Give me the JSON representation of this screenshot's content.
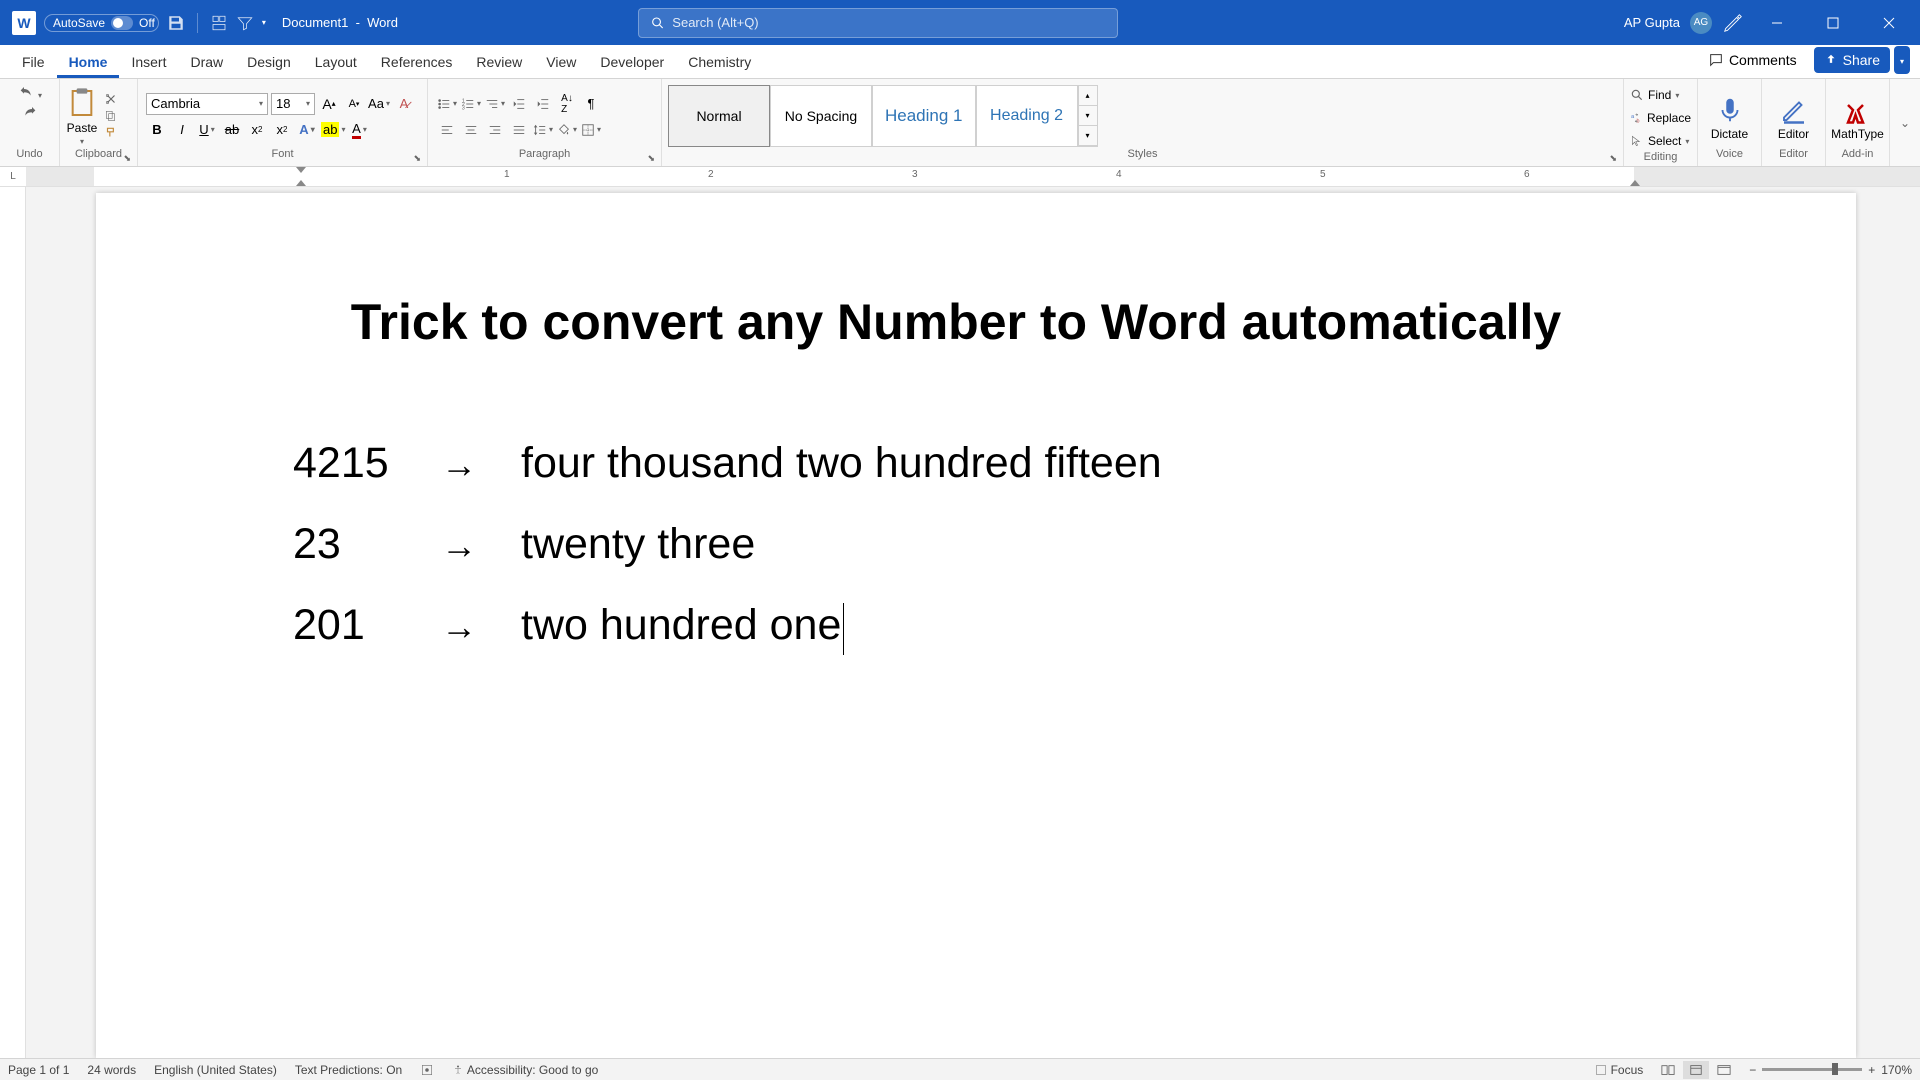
{
  "titlebar": {
    "autosave_label": "AutoSave",
    "autosave_state": "Off",
    "doc_name": "Document1",
    "app_name": "Word",
    "search_placeholder": "Search (Alt+Q)",
    "user_name": "AP Gupta",
    "user_initials": "AG"
  },
  "tabs": {
    "items": [
      "File",
      "Home",
      "Insert",
      "Draw",
      "Design",
      "Layout",
      "References",
      "Review",
      "View",
      "Developer",
      "Chemistry"
    ],
    "active": "Home",
    "comments": "Comments",
    "share": "Share"
  },
  "ribbon": {
    "undo": {
      "label": "Undo"
    },
    "clipboard": {
      "label": "Clipboard",
      "paste": "Paste"
    },
    "font": {
      "label": "Font",
      "font_name": "Cambria",
      "font_size": "18"
    },
    "paragraph": {
      "label": "Paragraph"
    },
    "styles": {
      "label": "Styles",
      "items": [
        "Normal",
        "No Spacing",
        "Heading 1",
        "Heading 2"
      ]
    },
    "editing": {
      "label": "Editing",
      "find": "Find",
      "replace": "Replace",
      "select": "Select"
    },
    "voice": {
      "label": "Voice",
      "dictate": "Dictate"
    },
    "editor": {
      "label": "Editor",
      "btn": "Editor"
    },
    "addin": {
      "label": "Add-in",
      "btn": "MathType"
    }
  },
  "document": {
    "title": "Trick to convert any Number to Word automatically",
    "rows": [
      {
        "num": "4215",
        "word": "four thousand two hundred fifteen"
      },
      {
        "num": "23",
        "word": "twenty three"
      },
      {
        "num": "201",
        "word": "two hundred one"
      }
    ]
  },
  "statusbar": {
    "page": "Page 1 of 1",
    "words": "24 words",
    "lang": "English (United States)",
    "predictions": "Text Predictions: On",
    "accessibility": "Accessibility: Good to go",
    "focus": "Focus",
    "zoom": "170%"
  },
  "ruler": {
    "numbers": [
      "1",
      "2",
      "3",
      "4",
      "5",
      "6"
    ]
  }
}
